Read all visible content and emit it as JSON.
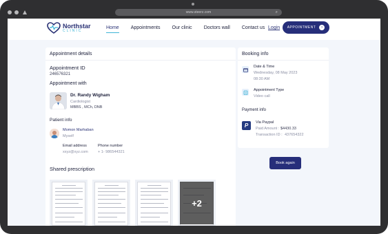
{
  "browser": {
    "url": "www.steerz.com"
  },
  "brand": {
    "name": "Northstar",
    "tagline": "CLINIC"
  },
  "nav": {
    "links": [
      "Home",
      "Appointments",
      "Our clinic",
      "Doctors wall",
      "Contact us"
    ],
    "active_index": 0,
    "login": "Login",
    "appointment_button": "APPOINTMENT"
  },
  "details": {
    "title": "Appointment details",
    "id_label": "Appointment ID",
    "id_value": "246576321",
    "with_label": "Appointment with",
    "doctor": {
      "name": "Dr. Randy Wigham",
      "specialty": "Cardiologist",
      "degrees": "MBBS , MCh, DNB"
    },
    "patient_label": "Patient info",
    "patient": {
      "name": "Momon Marhaban",
      "relation": "Myself"
    },
    "email_label": "Email address",
    "email_value": "xxyz@xyz.com",
    "phone_label": "Phone number",
    "phone_value": "+ 1- 986544321",
    "prescription_label": "Shared prescription",
    "more_count": "+2"
  },
  "booking": {
    "title": "Booking info",
    "datetime_label": "Date & Time",
    "date_value": "Wednesday, 08 May 2023",
    "time_value": "08:30 AM",
    "type_label": "Appointment Type",
    "type_value": "Video call",
    "payment_label": "Payment info",
    "payment_method": "Via Paypal",
    "paid_label": "Paid Amount :",
    "paid_value": "$4430.33",
    "txn_label": "Transaction ID :",
    "txn_value": "437654322"
  },
  "book_again": "Book again",
  "colors": {
    "primary": "#262e7a",
    "accent": "#3bb3d6",
    "background": "#f3f6fb"
  }
}
